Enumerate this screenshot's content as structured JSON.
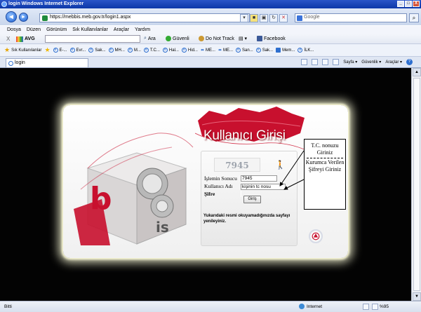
{
  "window": {
    "title": "login  Windows Internet Explorer",
    "minimize": "_",
    "maximize": "□",
    "close": "X"
  },
  "toolbar": {
    "back": "◄",
    "forward": "►",
    "address": "https://mebbis.meb.gov.tr/login1.aspx",
    "search_placeholder": "Google",
    "search_btn": "⌕"
  },
  "menu": {
    "items": [
      "Dosya",
      "Düzen",
      "Görünüm",
      "Sık Kullanılanlar",
      "Araçlar",
      "Yardım"
    ]
  },
  "avg": {
    "close": "X",
    "brand": "AVG",
    "search_label": "Ara",
    "guvenli": "Güvenli",
    "donottrack": "Do Not Track",
    "facebook": "Facebook"
  },
  "favorites": {
    "label": "Sık Kullanılanlar",
    "items": [
      "E-...",
      "Evr...",
      "Sak...",
      "MH...",
      "M...",
      "T.C...",
      "Hal...",
      "Hid...",
      "ME...",
      "ME...",
      "San...",
      "Sak...",
      "Mem...",
      "İLK..."
    ]
  },
  "tab": {
    "label": "login"
  },
  "tabtools": {
    "sayfa": "Sayfa ▾",
    "guvenlik": "Güvenlik ▾",
    "araclar": "Araçlar ▾"
  },
  "logo": {
    "text_b": "b",
    "text_is": "is"
  },
  "login": {
    "title": "Kullanıcı Girişi",
    "captcha": "7945",
    "captcha_label": "İşlemin Sonucu",
    "captcha_value": "7945",
    "user_label": "Kullanıcı Adı",
    "user_value": "kişinin tc nosu",
    "password_label": "Şifre",
    "password_value": "",
    "submit": "Giriş",
    "note": "Yukarıdaki resmi okuyamadığınızda sayfayı yenileyiniz."
  },
  "callout": {
    "part1": "T.C. nonuzu Giriniz",
    "part2": "Kurumca Verilen Şifreyi Giriniz"
  },
  "status": {
    "left": "Bitti",
    "zone": "Internet",
    "zoom": "%95"
  },
  "colors": {
    "brand_red": "#c8102e",
    "ie_blue": "#0c38a8"
  }
}
